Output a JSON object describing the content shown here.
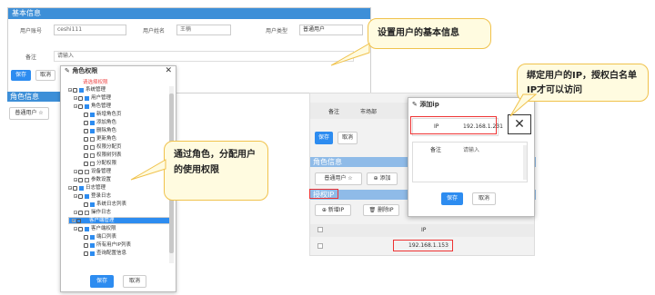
{
  "basic": {
    "title": "基本信息",
    "account_label": "用户账号",
    "account_value": "ceshi111",
    "name_label": "用户姓名",
    "name_value": "王楠",
    "type_label": "用户类型",
    "type_value": "普通用户",
    "note_label": "备注",
    "note_placeholder": "请输入",
    "save_label": "保存",
    "cancel_label": "取消"
  },
  "role_section": {
    "title": "角色信息",
    "role_button": "普通用户 ☆"
  },
  "callouts": {
    "basic": "设置用户的基本信息",
    "role": "通过角色，分配用户的使用权限",
    "ip": "绑定用户的IP，授权白名单IP才可以访问"
  },
  "role_dialog": {
    "title": "角色权限",
    "hint": "请选择权限",
    "save_label": "保存",
    "cancel_label": "取消",
    "tree": [
      {
        "label": "系统管理",
        "level": 0,
        "checked": true
      },
      {
        "label": "用户管理",
        "level": 1,
        "checked": true
      },
      {
        "label": "角色管理",
        "level": 1,
        "checked": true
      },
      {
        "label": "新增角色页",
        "level": 2,
        "checked": true
      },
      {
        "label": "添加角色",
        "level": 2,
        "checked": true
      },
      {
        "label": "删除角色",
        "level": 2,
        "checked": true
      },
      {
        "label": "更新角色",
        "level": 2,
        "checked": false
      },
      {
        "label": "权限分配页",
        "level": 2,
        "checked": false
      },
      {
        "label": "权限树列表",
        "level": 2,
        "checked": false
      },
      {
        "label": "分配权限",
        "level": 2,
        "checked": false
      },
      {
        "label": "设备管理",
        "level": 1,
        "checked": false
      },
      {
        "label": "参数设置",
        "level": 1,
        "checked": false
      },
      {
        "label": "日志管理",
        "level": 0,
        "checked": true
      },
      {
        "label": "登录日志",
        "level": 1,
        "checked": true
      },
      {
        "label": "系统日志列表",
        "level": 2,
        "checked": true
      },
      {
        "label": "操作日志",
        "level": 1,
        "checked": false
      },
      {
        "label": "客户端管理",
        "level": 0,
        "checked": true,
        "selected": true
      },
      {
        "label": "客户端权限",
        "level": 1,
        "checked": true
      },
      {
        "label": "端口列表",
        "level": 2,
        "checked": true
      },
      {
        "label": "所有用户IP列表",
        "level": 2,
        "checked": true
      },
      {
        "label": "查询配置信息",
        "level": 2,
        "checked": true
      }
    ]
  },
  "ip_screen": {
    "note_label": "备注",
    "note_value": "市场部",
    "save_label": "保存",
    "cancel_label": "取消",
    "role_title": "角色信息",
    "role_button": "普通用户 ☆",
    "add_label": "添加",
    "ip_section_title": "授权IP",
    "new_ip_label": "新增IP",
    "del_ip_label": "删除IP",
    "ip_col": "IP",
    "ip_value": "192.168.1.153"
  },
  "ip_dialog": {
    "title": "添加ip",
    "ip_label": "IP",
    "ip_value": "192.168.1.231",
    "note_label": "备注",
    "note_placeholder": "请输入",
    "save_label": "保存",
    "cancel_label": "取消"
  }
}
